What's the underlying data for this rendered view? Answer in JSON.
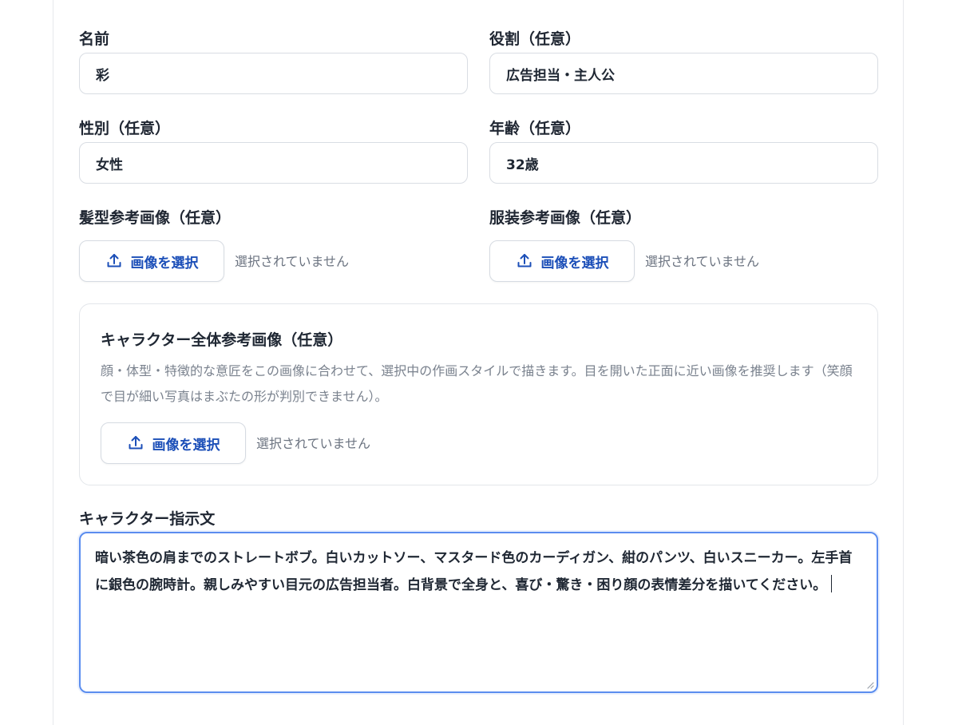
{
  "form": {
    "name": {
      "label": "名前",
      "value": "彩"
    },
    "role": {
      "label": "役割（任意）",
      "value": "広告担当・主人公"
    },
    "gender": {
      "label": "性別（任意）",
      "value": "女性"
    },
    "age": {
      "label": "年齢（任意）",
      "value": "32歳"
    },
    "hair_ref": {
      "label": "髪型参考画像（任意）",
      "button": "画像を選択",
      "status": "選択されていません"
    },
    "outfit_ref": {
      "label": "服装参考画像（任意）",
      "button": "画像を選択",
      "status": "選択されていません"
    },
    "full_ref": {
      "title": "キャラクター全体参考画像（任意）",
      "description": "顔・体型・特徴的な意匠をこの画像に合わせて、選択中の作画スタイルで描きます。目を開いた正面に近い画像を推奨します（笑顔で目が細い写真はまぶたの形が判別できません）。",
      "button": "画像を選択",
      "status": "選択されていません"
    },
    "prompt": {
      "label": "キャラクター指示文",
      "value": "暗い茶色の肩までのストレートボブ。白いカットソー、マスタード色のカーディガン、紺のパンツ、白いスニーカー。左手首に銀色の腕時計。親しみやすい目元の広告担当者。白背景で全身と、喜び・驚き・困り顔の表情差分を描いてください。"
    }
  },
  "icons": {
    "upload": "upload-icon"
  },
  "colors": {
    "accent": "#1c4fb8",
    "focus_border": "#5b8def",
    "muted_text": "#6b7380"
  }
}
